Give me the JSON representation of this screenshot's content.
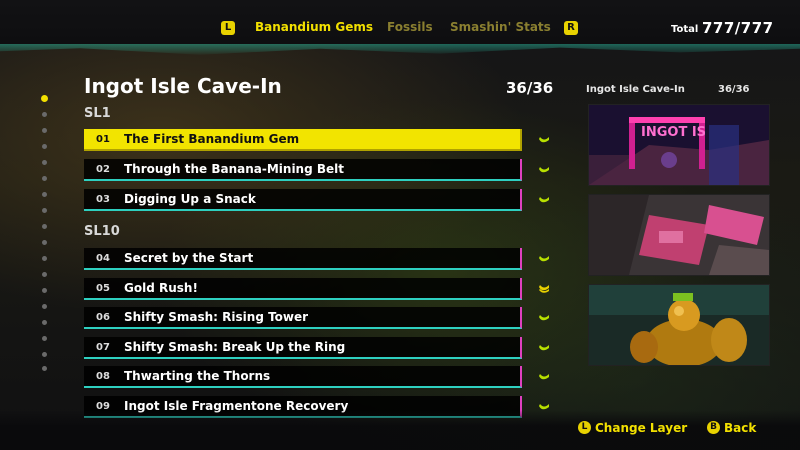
{
  "header": {
    "prev_button": "L",
    "next_button": "R",
    "tabs": [
      {
        "label": "Banandium Gems",
        "active": true
      },
      {
        "label": "Fossils",
        "active": false
      },
      {
        "label": "Smashin' Stats",
        "active": false
      }
    ],
    "total_label": "Total",
    "total_value": "777/777"
  },
  "stage": {
    "title": "Ingot Isle Cave-In",
    "count": "36/36"
  },
  "sections": [
    {
      "label": "SL1",
      "items": [
        {
          "num": "01",
          "name": "The First Banandium Gem",
          "selected": true,
          "icon": "banana-gem-icon"
        },
        {
          "num": "02",
          "name": "Through the Banana-Mining Belt",
          "selected": false,
          "icon": "banana-gem-icon"
        },
        {
          "num": "03",
          "name": "Digging Up a Snack",
          "selected": false,
          "icon": "banana-gem-icon"
        }
      ]
    },
    {
      "label": "SL10",
      "items": [
        {
          "num": "04",
          "name": "Secret by the Start",
          "selected": false,
          "icon": "banana-gem-icon"
        },
        {
          "num": "05",
          "name": "Gold Rush!",
          "selected": false,
          "icon": "banana-bunch-icon"
        },
        {
          "num": "06",
          "name": "Shifty Smash: Rising Tower",
          "selected": false,
          "icon": "banana-gem-icon"
        },
        {
          "num": "07",
          "name": "Shifty Smash: Break Up the Ring",
          "selected": false,
          "icon": "banana-gem-icon"
        },
        {
          "num": "08",
          "name": "Thwarting the Thorns",
          "selected": false,
          "icon": "banana-gem-icon"
        },
        {
          "num": "09",
          "name": "Ingot Isle Fragmentone Recovery",
          "selected": false,
          "icon": "banana-gem-icon"
        }
      ]
    }
  ],
  "preview": {
    "title": "Ingot Isle Cave-In",
    "count": "36/36",
    "sign_text": "INGOT IS"
  },
  "footer": {
    "change_layer_button": "L",
    "change_layer_label": "Change Layer",
    "back_button": "B",
    "back_label": "Back"
  },
  "colors": {
    "accent_yellow": "#f2e400",
    "border_cyan": "#2ed0c0",
    "border_magenta": "#e040c0"
  }
}
